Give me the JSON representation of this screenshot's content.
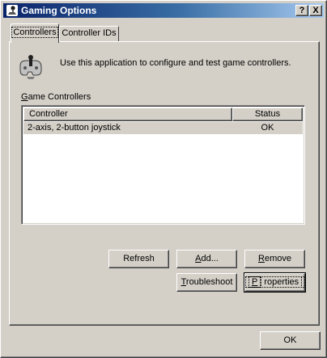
{
  "window": {
    "title": "Gaming Options",
    "help_label": "?",
    "close_label": "X"
  },
  "tabs": [
    {
      "label": "Controllers",
      "active": true
    },
    {
      "label": "Controller IDs",
      "active": false
    }
  ],
  "intro": {
    "text": "Use this application to configure and test game controllers."
  },
  "group": {
    "label_underlined": "G",
    "label_rest": "ame Controllers"
  },
  "list": {
    "columns": [
      "Controller",
      "Status"
    ],
    "rows": [
      {
        "controller": "2-axis, 2-button joystick",
        "status": "OK"
      }
    ]
  },
  "buttons": {
    "refresh": "Refresh",
    "add_underlined": "A",
    "add_rest": "dd...",
    "remove_underlined": "R",
    "remove_rest": "emove",
    "troubleshoot_underlined": "T",
    "troubleshoot_rest": "roubleshoot",
    "properties_underlined": "P",
    "properties_rest": "roperties",
    "ok": "OK"
  },
  "colors": {
    "titlebar_start": "#0a246a",
    "titlebar_end": "#a6caf0",
    "face": "#d4d0c8"
  }
}
